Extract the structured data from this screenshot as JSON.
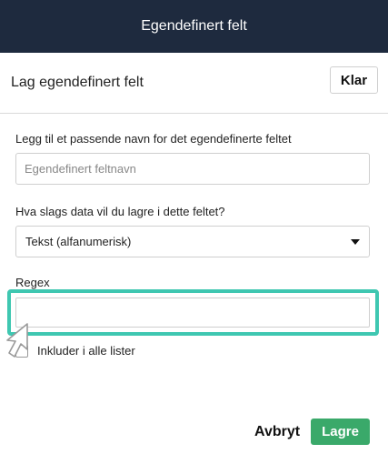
{
  "header": {
    "title": "Egendefinert felt"
  },
  "subheader": {
    "title": "Lag egendefinert felt",
    "done_label": "Klar"
  },
  "form": {
    "name_label": "Legg til et passende navn for det egendefinerte feltet",
    "name_placeholder": "Egendefinert feltnavn",
    "name_value": "",
    "type_label": "Hva slags data vil du lagre i dette feltet?",
    "type_value": "Tekst (alfanumerisk)",
    "regex_label": "Regex",
    "regex_value": "",
    "include_label": "Inkluder i alle lister",
    "include_checked": false
  },
  "footer": {
    "cancel_label": "Avbryt",
    "save_label": "Lagre"
  },
  "colors": {
    "header_bg": "#1e2a3e",
    "highlight": "#3fc7b1",
    "save_bg": "#3aa96a"
  },
  "icons": {
    "dropdown": "caret-down-icon",
    "pointer": "mouse-pointer-icon"
  }
}
